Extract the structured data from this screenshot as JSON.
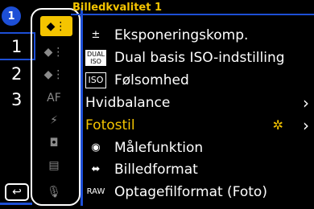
{
  "title": "Billedkvalitet 1",
  "page_badge": "1",
  "pages": [
    "1",
    "2",
    "3"
  ],
  "tabs": [
    {
      "name": "photo-quality-1-icon",
      "glyph": "◆⋮",
      "active": true
    },
    {
      "name": "photo-quality-2-icon",
      "glyph": "◆⋮",
      "active": false
    },
    {
      "name": "photo-quality-3-icon",
      "glyph": "◆⋮",
      "active": false
    },
    {
      "name": "af-icon",
      "glyph": "AF",
      "active": false
    },
    {
      "name": "flash-icon",
      "glyph": "⚡",
      "active": false
    },
    {
      "name": "camera-icon",
      "glyph": "◘",
      "active": false
    },
    {
      "name": "video-icon",
      "glyph": "▤",
      "active": false
    },
    {
      "name": "microphone-icon",
      "glyph": "🎙",
      "active": false
    }
  ],
  "menu": [
    {
      "icon": "±",
      "icon_name": "exposure-compensation-icon",
      "label": "Eksponeringskomp.",
      "has_submenu": false
    },
    {
      "icon": "DUAL ISO",
      "icon_name": "dual-iso-icon",
      "label": "Dual basis ISO-indstilling",
      "has_submenu": false
    },
    {
      "icon": "ISO",
      "icon_name": "iso-icon",
      "label": "Følsomhed",
      "has_submenu": false
    },
    {
      "icon": "",
      "icon_name": "",
      "label": "Hvidbalance",
      "has_submenu": true
    },
    {
      "icon": "",
      "icon_name": "",
      "label": "Fotostil",
      "has_submenu": true,
      "highlighted": true,
      "value_glyph": "✲"
    },
    {
      "icon": "◉",
      "icon_name": "metering-icon",
      "label": "Målefunktion",
      "has_submenu": false
    },
    {
      "icon": "⬌",
      "icon_name": "aspect-ratio-icon",
      "label": "Billedformat",
      "has_submenu": false
    },
    {
      "icon": "RAW",
      "icon_name": "raw-icon",
      "label": "Optagefilformat (Foto)",
      "has_submenu": false
    }
  ],
  "back_glyph": "↩",
  "colors": {
    "accent": "#f4c400",
    "selection": "#1d4fd6"
  }
}
